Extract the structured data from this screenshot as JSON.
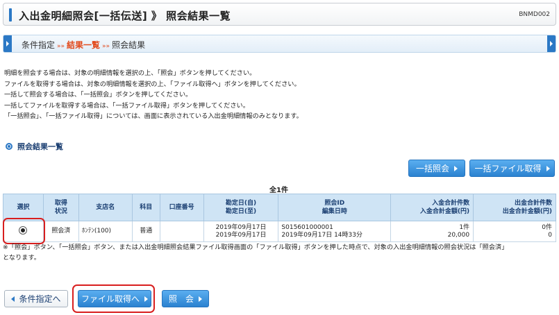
{
  "header": {
    "title": "入出金明細照会[一括伝送] 》 照会結果一覧",
    "screen_code": "BNMD002"
  },
  "breadcrumb": {
    "step1": "条件指定",
    "step2": "結果一覧",
    "step3": "照会結果",
    "separator": "»»"
  },
  "instructions": [
    "明細を照会する場合は、対象の明細情報を選択の上、「照会」ボタンを押してください。",
    "ファイルを取得する場合は、対象の明細情報を選択の上、「ファイル取得へ」ボタンを押してください。",
    "一括して照会する場合は、「一括照会」ボタンを押してください。",
    "一括してファイルを取得する場合は、「一括ファイル取得」ボタンを押してください。",
    "「一括照会」、「一括ファイル取得」については、画面に表示されている入出金明細情報のみとなります。"
  ],
  "section": {
    "title": "照会結果一覧"
  },
  "bulk_buttons": {
    "bulk_inquiry": "一括照会",
    "bulk_file": "一括ファイル取得"
  },
  "table": {
    "count": "全1件",
    "headers": {
      "select": "選択",
      "status_1": "取得",
      "status_2": "状況",
      "branch": "支店名",
      "subject": "科目",
      "account": "口座番号",
      "date_1": "勘定日(自)",
      "date_2": "勘定日(至)",
      "id_1": "照会ID",
      "id_2": "編集日時",
      "deposit_1": "入金合計件数",
      "deposit_2": "入金合計金額(円)",
      "withdraw_1": "出金合計件数",
      "withdraw_2": "出金合計金額(円)"
    },
    "rows": [
      {
        "status": "照会済",
        "branch": "ﾎﾝﾃﾝ(100)",
        "subject": "普通",
        "account": "",
        "date_from": "2019年09月17日",
        "date_to": "2019年09月17日",
        "inquiry_id": "S015601000001",
        "edit_time": "2019年09月17日 14時33分",
        "deposit_count": "1件",
        "deposit_amount": "20,000",
        "withdraw_count": "0件",
        "withdraw_amount": "0"
      }
    ]
  },
  "note": {
    "line1": "※「照会」ボタン、「一括照会」ボタン、または入出金明細照会結果ファイル取得画面の「ファイル取得」ボタンを押した時点で、対象の入出金明細情報の照会状況は「照会済」",
    "line2": "となります。"
  },
  "footer_buttons": {
    "back": "条件指定へ",
    "file": "ファイル取得へ",
    "inquiry": "照　会"
  },
  "colors": {
    "accent": "#2b78c5",
    "active_step": "#e24a1c",
    "highlight": "#d81e1e",
    "header_bg": "#cfe4f5"
  }
}
